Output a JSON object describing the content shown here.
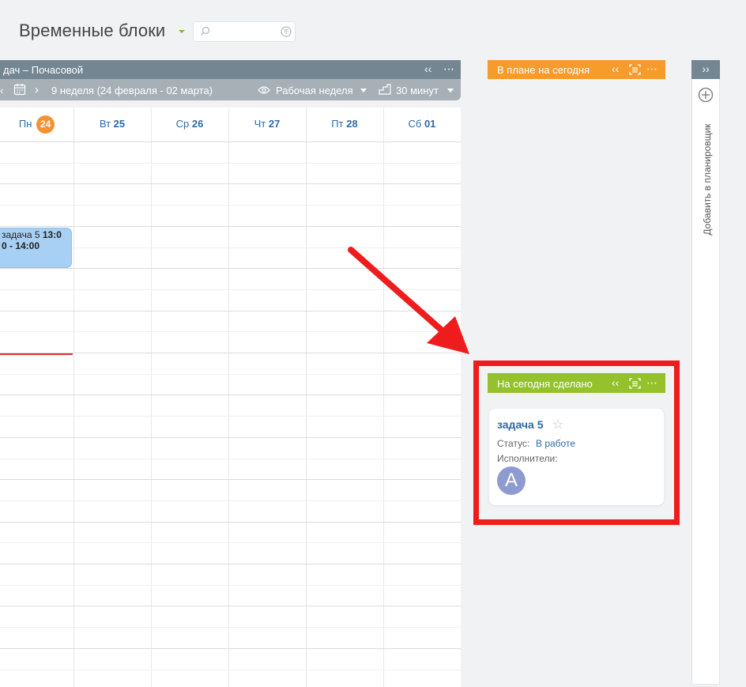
{
  "page": {
    "title": "Временные блоки"
  },
  "search": {
    "placeholder": ""
  },
  "calendar": {
    "header_title": "дач – Почасовой",
    "collapse_icon": "double-chevron-left",
    "more_icon": "ellipsis",
    "week_label": "9 неделя (24 февраля - 02 марта)",
    "view_label": "Рабочая неделя",
    "step_label": "30 минут",
    "days": [
      {
        "name": "Пн",
        "num": "24",
        "today": true
      },
      {
        "name": "Вт",
        "num": "25"
      },
      {
        "name": "Ср",
        "num": "26"
      },
      {
        "name": "Чт",
        "num": "27"
      },
      {
        "name": "Пт",
        "num": "28"
      },
      {
        "name": "Сб",
        "num": "01"
      }
    ],
    "event": {
      "line1_text": "задача 5 ",
      "line1_time": "13:0",
      "line2": "0 - 14:00"
    }
  },
  "plan_today": {
    "title": "В плане на сегодня"
  },
  "done_today": {
    "title": "На сегодня сделано",
    "card": {
      "task_name": "задача 5",
      "status_label": "Статус:",
      "status_value": "В работе",
      "assignees_label": "Исполнители:",
      "avatar_letter": "A"
    }
  },
  "rail": {
    "expand_icon": "double-chevron-right",
    "add_label": "Добавить в планировщик"
  },
  "colors": {
    "plan_header": "#f79b2c",
    "done_header": "#94c12c",
    "calendar_header": "#748692",
    "today_badge": "#f59333",
    "event_fill": "#a8d0f4",
    "highlight": "#ee1c1c",
    "arrow": "#ee1c1c",
    "link": "#2d6ba6"
  }
}
